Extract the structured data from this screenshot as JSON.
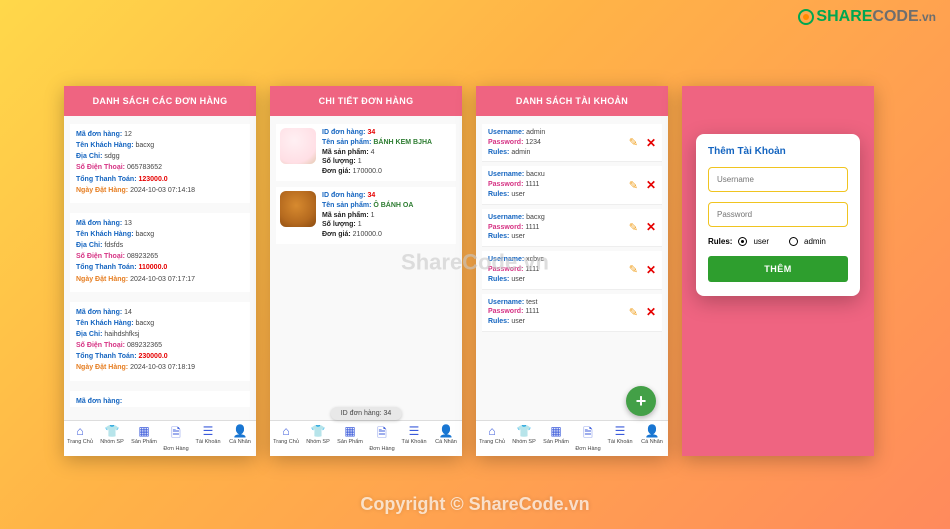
{
  "logo": {
    "share": "SHARE",
    "code": "CODE",
    "vn": ".vn"
  },
  "watermark": "ShareCode.vn",
  "copyright": "Copyright © ShareCode.vn",
  "nav": {
    "items": [
      {
        "label": "Trang Chủ",
        "icon": "⌂"
      },
      {
        "label": "Nhóm SP",
        "icon": "👕"
      },
      {
        "label": "Sản Phẩm",
        "icon": "▦"
      },
      {
        "label": "Đơn Hàng",
        "icon": "🗎"
      },
      {
        "label": "Tài Khoản",
        "icon": "☰"
      },
      {
        "label": "Cá Nhân",
        "icon": "👤"
      }
    ]
  },
  "screen1": {
    "title": "DANH SÁCH CÁC ĐƠN HÀNG",
    "labels": {
      "order_id": "Mã đơn hàng:",
      "customer": "Tên Khách Hàng:",
      "address": "Địa Chỉ:",
      "phone": "Số Điện Thoại:",
      "total": "Tổng Thanh Toán:",
      "date": "Ngày Đặt Hàng:"
    },
    "orders": [
      {
        "id": "12",
        "name": "bacxg",
        "addr": "sdgg",
        "phone": "065783652",
        "total": "123000.0",
        "date": "2024-10-03 07:14:18"
      },
      {
        "id": "13",
        "name": "bacxg",
        "addr": "fdsfds",
        "phone": "08923265",
        "total": "110000.0",
        "date": "2024-10-03 07:17:17"
      },
      {
        "id": "14",
        "name": "bacxg",
        "addr": "haihdshfksj",
        "phone": "089232365",
        "total": "230000.0",
        "date": "2024-10-03 07:18:19"
      }
    ],
    "cutoff_label": "Mã đơn hàng:"
  },
  "screen2": {
    "title": "CHI TIẾT ĐƠN HÀNG",
    "labels": {
      "order_id": "ID đơn hàng:",
      "product_name": "Tên sản phẩm:",
      "product_id": "Mã sản phẩm:",
      "qty": "Số lượng:",
      "price": "Đơn giá:"
    },
    "items": [
      {
        "order_id": "34",
        "name": "BÁNH KEM BJHA",
        "pid": "4",
        "qty": "1",
        "price": "170000.0",
        "img": "cake"
      },
      {
        "order_id": "34",
        "name": "Ô BÁNH OA",
        "pid": "1",
        "qty": "1",
        "price": "210000.0",
        "img": "balls"
      }
    ],
    "toast": "ID đơn hàng: 34"
  },
  "screen3": {
    "title": "DANH SÁCH TÀI KHOẢN",
    "labels": {
      "user": "Username:",
      "pass": "Password:",
      "rules": "Rules:"
    },
    "accounts": [
      {
        "user": "admin",
        "pass": "1234",
        "rules": "admin"
      },
      {
        "user": "bacxu",
        "pass": "1111",
        "rules": "user"
      },
      {
        "user": "bacxg",
        "pass": "1111",
        "rules": "user"
      },
      {
        "user": "xcbvc",
        "pass": "1111",
        "rules": "user"
      },
      {
        "user": "test",
        "pass": "1111",
        "rules": "user"
      }
    ],
    "fab": "+"
  },
  "screen4": {
    "form_title": "Thêm Tài Khoản",
    "placeholder_user": "Username",
    "placeholder_pass": "Password",
    "rules_label": "Rules:",
    "opt_user": "user",
    "opt_admin": "admin",
    "btn": "THÊM"
  }
}
